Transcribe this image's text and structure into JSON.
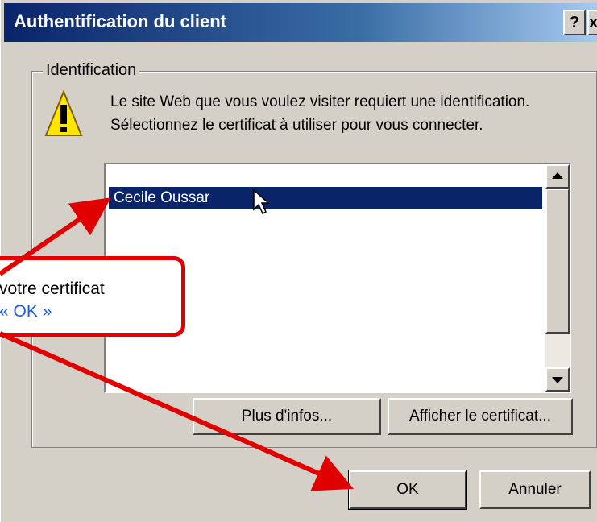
{
  "dialog": {
    "title": "Authentification du client",
    "help_label": "?",
    "close_label": "x"
  },
  "group": {
    "label": "Identification",
    "message_line1": "Le site Web que vous voulez visiter requiert une identification.",
    "message_line2": "Sélectionnez le certificat à utiliser pour vous connecter.",
    "certificates": [
      "Cecile Oussar"
    ]
  },
  "buttons": {
    "more_info": "Plus d'infos...",
    "view_cert": "Afficher le certificat...",
    "ok": "OK",
    "cancel": "Annuler"
  },
  "callout": {
    "line1": "votre certificat",
    "line2": "« OK »"
  },
  "colors": {
    "annotation": "#e00000",
    "selection": "#0a246a",
    "callout_link": "#1a5fe0"
  },
  "icons": [
    "warning-icon",
    "help-icon",
    "close-icon",
    "scroll-up-icon",
    "scroll-down-icon",
    "mouse-cursor-icon"
  ]
}
